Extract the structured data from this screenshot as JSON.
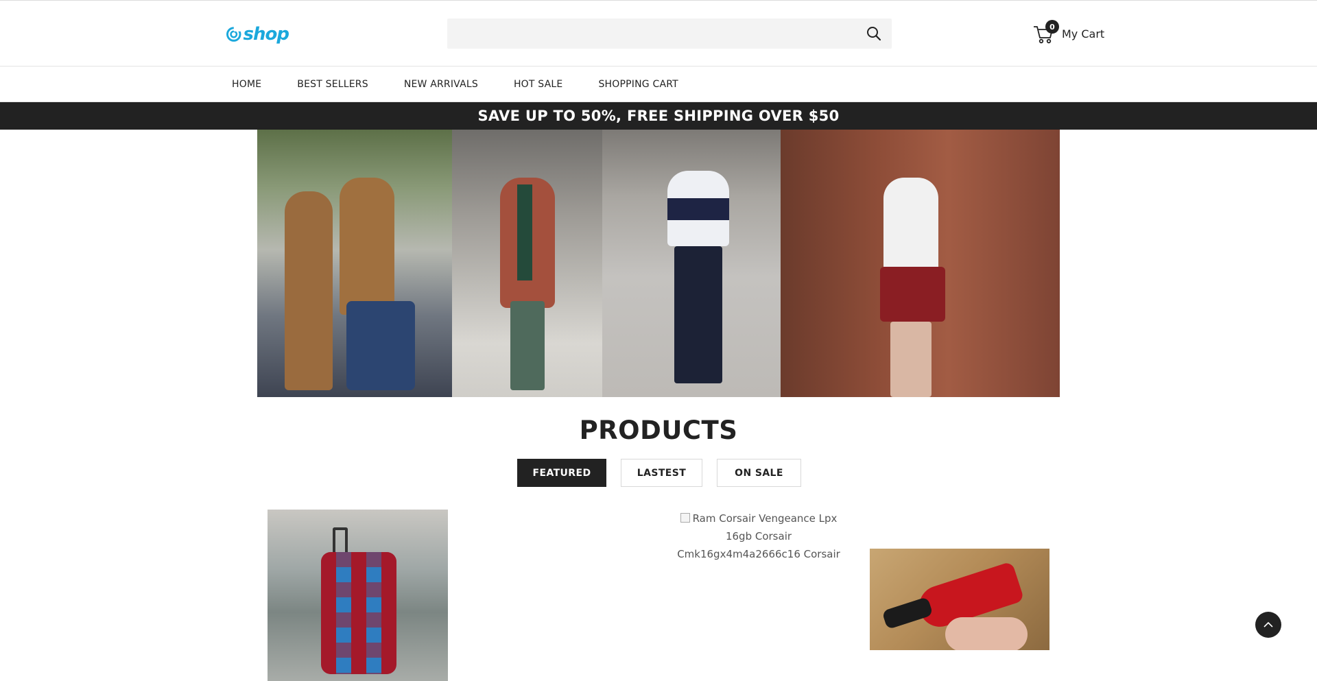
{
  "header": {
    "logo_text": "shop",
    "search_placeholder": "",
    "cart_count": "0",
    "cart_label": "My Cart"
  },
  "nav": {
    "items": [
      "HOME",
      "BEST SELLERS",
      "NEW ARRIVALS",
      "HOT SALE",
      "SHOPPING CART"
    ]
  },
  "promo": {
    "text": "SAVE UP TO 50%, FREE SHIPPING OVER $50"
  },
  "products": {
    "title": "PRODUCTS",
    "tabs": [
      "FEATURED",
      "LASTEST",
      "ON SALE"
    ],
    "active_tab": "FEATURED",
    "items": [
      {
        "alt": "",
        "image": "patterned-luggage-cover"
      },
      {
        "alt": "Ram Corsair Vengeance Lpx 16gb Corsair Cmk16gx4m4a2666c16 Corsair",
        "image": "broken-image"
      },
      {
        "alt": "",
        "image": "red-cordless-screwdriver"
      }
    ]
  },
  "colors": {
    "brand": "#1ba8dc",
    "dark": "#222222",
    "search_bg": "#f3f3f3"
  }
}
